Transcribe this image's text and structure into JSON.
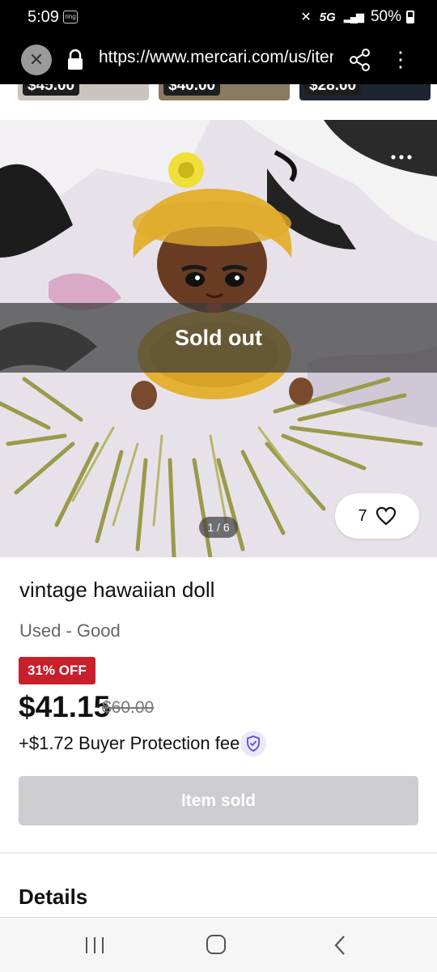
{
  "status_bar": {
    "time": "5:09",
    "notification_badge": "ring",
    "network": "5G",
    "battery": "50%"
  },
  "browser": {
    "url": "https://www.mercari.com/us/item/",
    "close_icon": "close-icon",
    "lock_icon": "lock-icon",
    "share_icon": "share-icon",
    "menu_icon": "more-vertical-icon"
  },
  "related_items": [
    {
      "price": "$45.00"
    },
    {
      "price": "$40.00"
    },
    {
      "price": "$28.00"
    }
  ],
  "gallery": {
    "sold_banner": "Sold out",
    "page_indicator": "1 / 6",
    "like_count": "7"
  },
  "product": {
    "title": "vintage hawaiian doll",
    "condition": "Used - Good",
    "discount": "31% OFF",
    "price": "$41.15",
    "original_price": "$60.00",
    "fee_text": "+$1.72 Buyer Protection fee",
    "button_label": "Item sold"
  },
  "sections": {
    "details_heading": "Details"
  },
  "colors": {
    "discount_red": "#c8202b",
    "disabled_button": "#ccccd1",
    "status_bar": "#000000"
  }
}
